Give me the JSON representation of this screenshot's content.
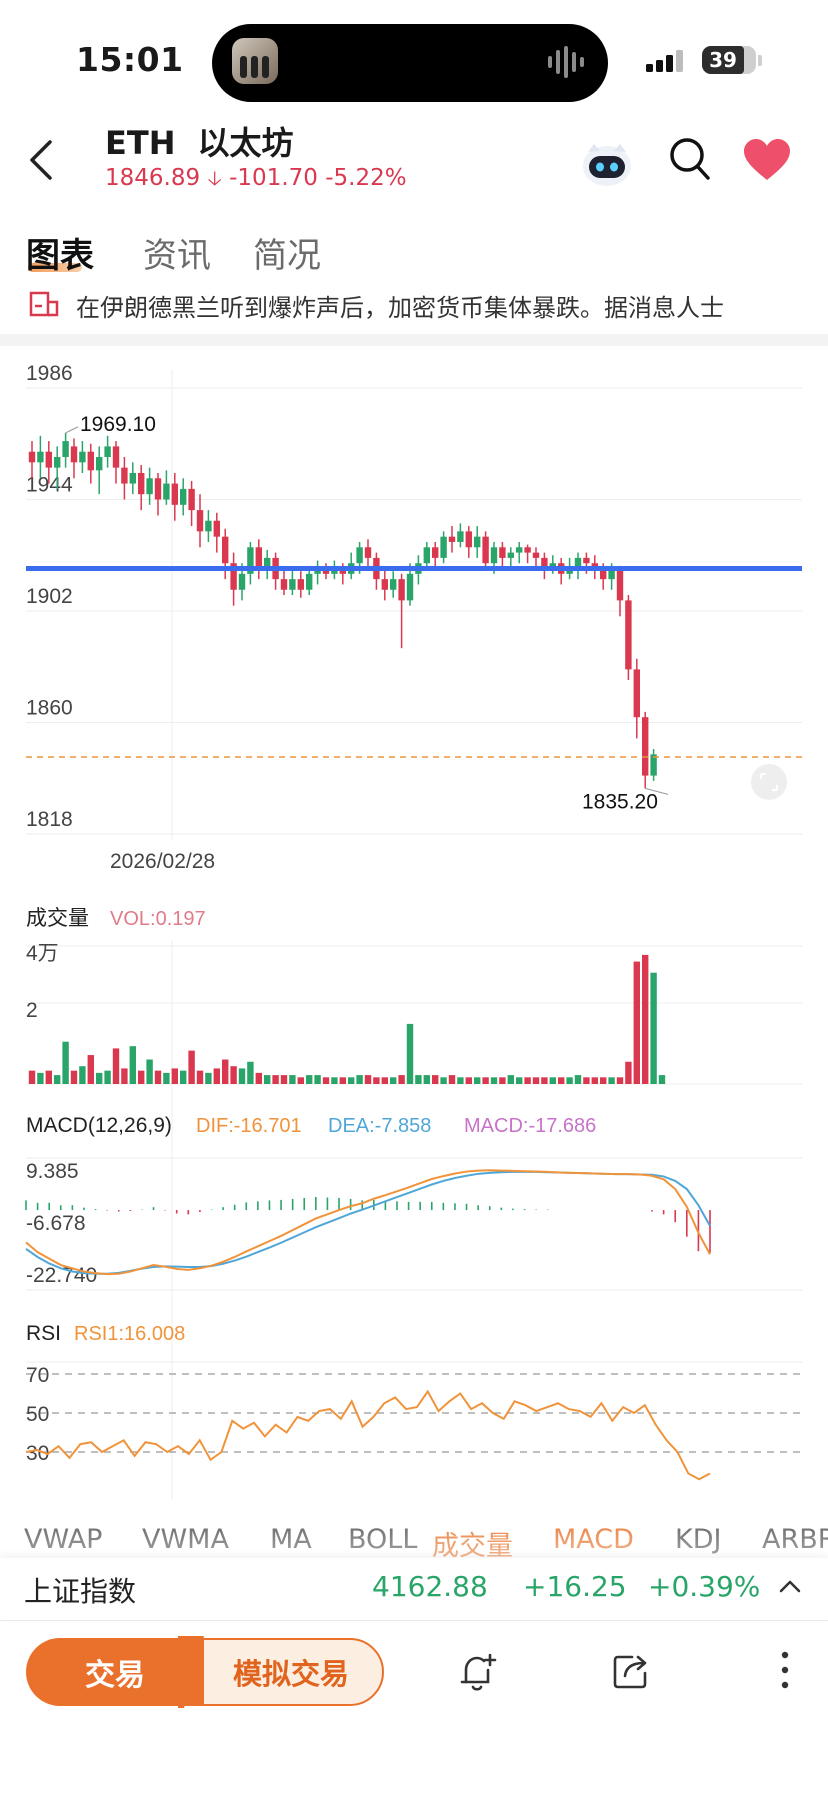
{
  "status_bar": {
    "time": "15:01",
    "battery": "39"
  },
  "header": {
    "symbol": "ETH",
    "name_cn": "以太坊",
    "price": "1846.89",
    "change": "-101.70",
    "change_pct": "-5.22%"
  },
  "tabs": [
    "图表",
    "资讯",
    "简况"
  ],
  "news": "在伊朗德黑兰听到爆炸声后，加密货币集体暴跌。据消息人士",
  "chart_data": {
    "type": "candlestick",
    "price_axis": {
      "ticks": [
        "1986",
        "1944",
        "1902",
        "1860",
        "1818"
      ],
      "ylim": [
        1818,
        1986
      ]
    },
    "date_label": "2026/02/28",
    "high_label": "1969.10",
    "low_label": "1835.20",
    "support_level": 1918,
    "last_price_line": 1847,
    "candles": [
      [
        1962,
        1958,
        1966,
        1952
      ],
      [
        1958,
        1962,
        1968,
        1952
      ],
      [
        1962,
        1956,
        1966,
        1950
      ],
      [
        1956,
        1960,
        1964,
        1948
      ],
      [
        1960,
        1966,
        1969.1,
        1956
      ],
      [
        1964,
        1958,
        1967,
        1952
      ],
      [
        1958,
        1962,
        1966,
        1954
      ],
      [
        1962,
        1955,
        1965,
        1950
      ],
      [
        1955,
        1960,
        1964,
        1946
      ],
      [
        1960,
        1964,
        1968,
        1956
      ],
      [
        1964,
        1956,
        1966,
        1950
      ],
      [
        1956,
        1950,
        1960,
        1944
      ],
      [
        1950,
        1954,
        1958,
        1946
      ],
      [
        1954,
        1946,
        1957,
        1940
      ],
      [
        1946,
        1952,
        1956,
        1942
      ],
      [
        1952,
        1944,
        1954,
        1938
      ],
      [
        1944,
        1950,
        1955,
        1942
      ],
      [
        1950,
        1942,
        1954,
        1936
      ],
      [
        1942,
        1948,
        1952,
        1938
      ],
      [
        1948,
        1940,
        1951,
        1934
      ],
      [
        1940,
        1932,
        1946,
        1926
      ],
      [
        1932,
        1936,
        1940,
        1928
      ],
      [
        1936,
        1930,
        1939,
        1924
      ],
      [
        1930,
        1920,
        1933,
        1914
      ],
      [
        1920,
        1910,
        1924,
        1904
      ],
      [
        1910,
        1916,
        1920,
        1906
      ],
      [
        1916,
        1926,
        1928,
        1912
      ],
      [
        1926,
        1918,
        1929,
        1914
      ],
      [
        1918,
        1922,
        1925,
        1914
      ],
      [
        1922,
        1914,
        1924,
        1910
      ],
      [
        1914,
        1910,
        1918,
        1908
      ],
      [
        1910,
        1914,
        1918,
        1908
      ],
      [
        1914,
        1910,
        1917,
        1907
      ],
      [
        1910,
        1916,
        1919,
        1908
      ],
      [
        1916,
        1918,
        1921,
        1912
      ],
      [
        1918,
        1916,
        1920,
        1914
      ],
      [
        1916,
        1918,
        1921,
        1914
      ],
      [
        1918,
        1916,
        1920,
        1912
      ],
      [
        1916,
        1920,
        1924,
        1914
      ],
      [
        1920,
        1926,
        1928,
        1916
      ],
      [
        1926,
        1922,
        1929,
        1918
      ],
      [
        1922,
        1914,
        1924,
        1910
      ],
      [
        1914,
        1910,
        1918,
        1906
      ],
      [
        1910,
        1914,
        1917,
        1907
      ],
      [
        1914,
        1906,
        1916,
        1888
      ],
      [
        1906,
        1916,
        1920,
        1904
      ],
      [
        1916,
        1920,
        1923,
        1912
      ],
      [
        1920,
        1926,
        1928,
        1918
      ],
      [
        1926,
        1922,
        1928,
        1918
      ],
      [
        1922,
        1930,
        1932,
        1920
      ],
      [
        1930,
        1928,
        1934,
        1924
      ],
      [
        1928,
        1932,
        1935,
        1926
      ],
      [
        1932,
        1926,
        1934,
        1922
      ],
      [
        1926,
        1930,
        1934,
        1922
      ],
      [
        1930,
        1920,
        1932,
        1918
      ],
      [
        1920,
        1926,
        1928,
        1916
      ],
      [
        1926,
        1922,
        1928,
        1918
      ],
      [
        1922,
        1924,
        1926,
        1918
      ],
      [
        1924,
        1926,
        1928,
        1920
      ],
      [
        1926,
        1924,
        1927,
        1920
      ],
      [
        1924,
        1922,
        1926,
        1918
      ],
      [
        1922,
        1918,
        1924,
        1914
      ],
      [
        1918,
        1920,
        1923,
        1916
      ],
      [
        1920,
        1916,
        1922,
        1912
      ],
      [
        1916,
        1918,
        1922,
        1914
      ],
      [
        1918,
        1922,
        1924,
        1914
      ],
      [
        1922,
        1920,
        1924,
        1916
      ],
      [
        1920,
        1918,
        1923,
        1914
      ],
      [
        1918,
        1914,
        1920,
        1910
      ],
      [
        1914,
        1918,
        1920,
        1910
      ],
      [
        1918,
        1906,
        1919,
        1900
      ],
      [
        1906,
        1880,
        1908,
        1876
      ],
      [
        1880,
        1862,
        1884,
        1854
      ],
      [
        1862,
        1840,
        1864,
        1835.2
      ],
      [
        1840,
        1848,
        1850,
        1838
      ]
    ],
    "vol_axis": [
      "4万",
      "2"
    ],
    "volumes": [
      0.6,
      0.5,
      0.6,
      0.4,
      1.9,
      0.6,
      0.8,
      1.3,
      0.5,
      0.6,
      1.6,
      0.7,
      1.7,
      0.6,
      1.1,
      0.6,
      0.5,
      0.7,
      0.6,
      1.5,
      0.6,
      0.5,
      0.7,
      1.1,
      0.8,
      0.7,
      1.0,
      0.5,
      0.4,
      0.4,
      0.4,
      0.4,
      0.3,
      0.4,
      0.4,
      0.3,
      0.3,
      0.3,
      0.3,
      0.4,
      0.4,
      0.3,
      0.3,
      0.3,
      0.4,
      2.7,
      0.4,
      0.4,
      0.4,
      0.3,
      0.4,
      0.3,
      0.3,
      0.3,
      0.3,
      0.3,
      0.3,
      0.4,
      0.3,
      0.3,
      0.3,
      0.3,
      0.3,
      0.3,
      0.3,
      0.4,
      0.3,
      0.3,
      0.3,
      0.3,
      0.3,
      1.0,
      5.5,
      5.8,
      5.0,
      0.4
    ],
    "macd_axis": [
      "9.385",
      "-6.678",
      "-22.740"
    ],
    "macd_ylim": [
      -24,
      10
    ],
    "dif": [
      -13,
      -16,
      -18,
      -20,
      -21,
      -22,
      -22.5,
      -22.8,
      -22.7,
      -22,
      -21,
      -20,
      -20.5,
      -21.2,
      -21.5,
      -21,
      -20.2,
      -19,
      -17.5,
      -15.8,
      -14.2,
      -12.6,
      -11,
      -9.2,
      -7.4,
      -5.6,
      -4.3,
      -3,
      -1.8,
      -0.9,
      0.5,
      1.6,
      2.8,
      4,
      5.3,
      6.6,
      7.5,
      8.3,
      8.9,
      9.2,
      9.3,
      9.2,
      9.1,
      9,
      8.9,
      8.8,
      8.6,
      8.5,
      8.4,
      8.3,
      8.2,
      8.1,
      8.1,
      8,
      7.6,
      6.5,
      3.5,
      -2,
      -10,
      -16.7
    ],
    "dea": [
      -15,
      -17.5,
      -19.5,
      -21,
      -22,
      -22.5,
      -22.7,
      -22.7,
      -22.4,
      -21.8,
      -21.1,
      -20.6,
      -20.4,
      -20.5,
      -20.6,
      -20.6,
      -20.3,
      -19.6,
      -18.6,
      -17.4,
      -16,
      -14.6,
      -13.1,
      -11.5,
      -9.9,
      -8.3,
      -6.9,
      -5.5,
      -4.1,
      -2.9,
      -1.6,
      -0.3,
      1,
      2.3,
      3.6,
      4.9,
      6,
      6.9,
      7.6,
      8.2,
      8.5,
      8.7,
      8.8,
      8.8,
      8.8,
      8.7,
      8.6,
      8.5,
      8.4,
      8.3,
      8.2,
      8.1,
      8.1,
      8,
      7.9,
      7.4,
      6,
      3.5,
      -1.5,
      -7.9
    ],
    "rsi_axis": [
      "70",
      "50",
      "30"
    ],
    "rsi": [
      30,
      31,
      29,
      33,
      27,
      34,
      35,
      30,
      33,
      36,
      28,
      35,
      34,
      30,
      33,
      29,
      36,
      26,
      30,
      46,
      42,
      45,
      38,
      44,
      40,
      48,
      46,
      51,
      52,
      47,
      56,
      43,
      48,
      55,
      58,
      52,
      53,
      61,
      51,
      56,
      60,
      52,
      55,
      50,
      47,
      56,
      54,
      51,
      53,
      55,
      52,
      51,
      48,
      55,
      46,
      53,
      50,
      54,
      44,
      36,
      30,
      19,
      16,
      19
    ],
    "legends": {
      "vol_title": "成交量",
      "vol": "VOL:0.197",
      "macd_title": "MACD(12,26,9)",
      "dif": "DIF:-16.701",
      "dea": "DEA:-7.858",
      "macd": "MACD:-17.686",
      "rsi_title": "RSI",
      "rsi1": "RSI1:16.008"
    },
    "colors": {
      "up": "#2aa56a",
      "down": "#d9384f",
      "support": "#3a6cf0",
      "dif": "#f0933a",
      "dea": "#4fa7d8"
    }
  },
  "indicators": [
    "VWAP",
    "VWMA",
    "MA",
    "BOLL",
    "成交量",
    "MACD",
    "KDJ",
    "ARBR"
  ],
  "index_ticker": {
    "name": "上证指数",
    "value": "4162.88",
    "change": "+16.25",
    "pct": "+0.39%"
  },
  "actions": {
    "trade": "交易",
    "sim_trade": "模拟交易"
  }
}
